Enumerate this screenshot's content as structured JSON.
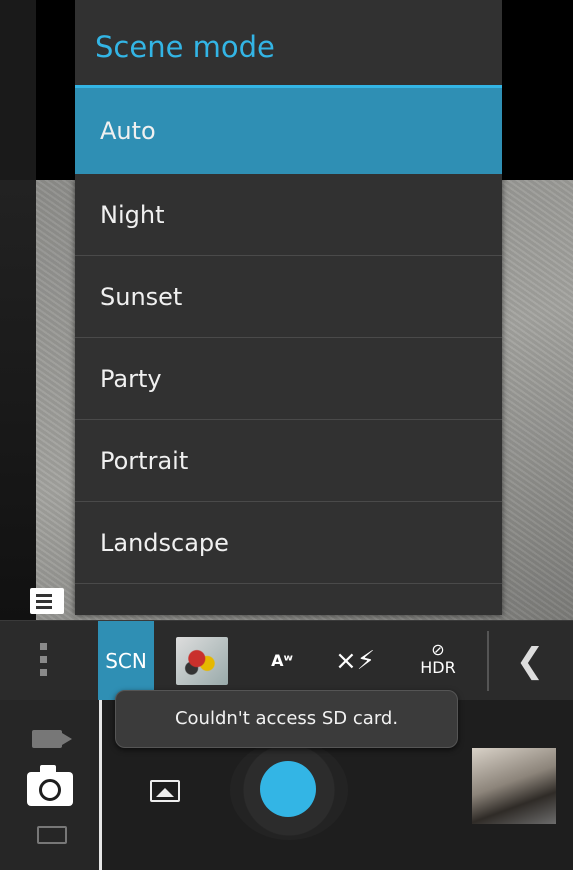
{
  "scene_menu": {
    "title": "Scene mode",
    "items": [
      {
        "label": "Auto",
        "selected": true
      },
      {
        "label": "Night",
        "selected": false
      },
      {
        "label": "Sunset",
        "selected": false
      },
      {
        "label": "Party",
        "selected": false
      },
      {
        "label": "Portrait",
        "selected": false
      },
      {
        "label": "Landscape",
        "selected": false
      }
    ]
  },
  "settings_bar": {
    "scn_label": "SCN",
    "awb_label": "Aʷ",
    "flash_label": "×⚡",
    "hdr_label": "HDR",
    "collapse_glyph": "❮"
  },
  "toast": {
    "message": "Couldn't access SD card."
  },
  "colors": {
    "accent": "#33b5e5",
    "selected_bg": "#2f8fb4",
    "menu_bg": "#313131"
  },
  "icons": [
    "document-icon",
    "more-options-icon",
    "scene-thumbnail-icon",
    "white-balance-icon",
    "flash-off-icon",
    "hdr-off-icon",
    "collapse-chevron-icon",
    "video-mode-icon",
    "camera-mode-icon",
    "panorama-mode-icon",
    "gallery-icon",
    "shutter-button",
    "last-photo-thumbnail"
  ]
}
